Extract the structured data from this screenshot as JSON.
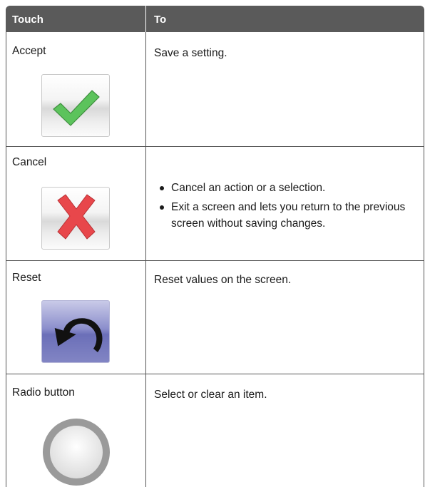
{
  "table": {
    "headers": {
      "touch": "Touch",
      "to": "To"
    },
    "rows": [
      {
        "label": "Accept",
        "icon": "checkmark-icon",
        "description": "Save a setting."
      },
      {
        "label": "Cancel",
        "icon": "cross-icon",
        "bullets": [
          "Cancel an action or a selection.",
          "Exit a screen and lets you return to the previous screen without saving changes."
        ]
      },
      {
        "label": "Reset",
        "icon": "undo-arrow-icon",
        "description": "Reset values on the screen."
      },
      {
        "label": "Radio button",
        "icon": "radio-button-icon",
        "description": "Select or clear an item."
      }
    ]
  },
  "colors": {
    "header_bg": "#5a5a5a",
    "check_green": "#5cc35c",
    "cross_red": "#e8474b",
    "reset_blue": "#6b6fb8"
  }
}
